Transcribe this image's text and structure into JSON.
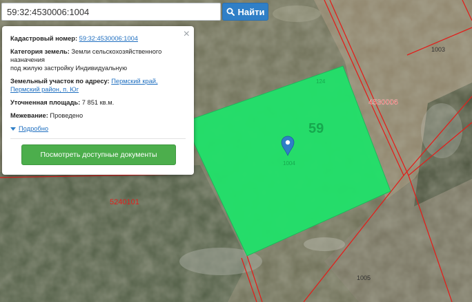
{
  "search": {
    "value": "59:32:4530006:1004",
    "button_label": "Найти"
  },
  "popup": {
    "close_symbol": "×",
    "cadastral_label": "Кадастровый номер:",
    "cadastral_value": "59:32:4530006:1004",
    "category_label": "Категория земель:",
    "category_value_1": "Земли сельскохозяйственного",
    "category_value_2": "назначения",
    "category_value_3": "под жилую застройку Индивидуальную",
    "address_label": "Земельный участок по адресу:",
    "address_link_1": "Пермский край,",
    "address_link_2": "Пермский район, п. Юг",
    "area_label": "Уточненная площадь:",
    "area_value": "7 851 кв.м.",
    "survey_label": "Межевание:",
    "survey_value": "Проведено",
    "more_label": "Подробно",
    "documents_button": "Посмотреть доступные документы"
  },
  "map": {
    "parcel_fill": "#22e06a",
    "boundary_color": "#e0201c",
    "labels": {
      "quarter_right": "4530006",
      "quarter_left": "5240101",
      "big_number": "59",
      "plot_1003": "1003",
      "plot_124": "124",
      "plot_1004": "1004",
      "plot_1005": "1005"
    }
  },
  "icons": {
    "search": "search-icon",
    "marker": "map-marker-icon",
    "close": "close-icon",
    "expand": "expand-triangle-icon"
  }
}
